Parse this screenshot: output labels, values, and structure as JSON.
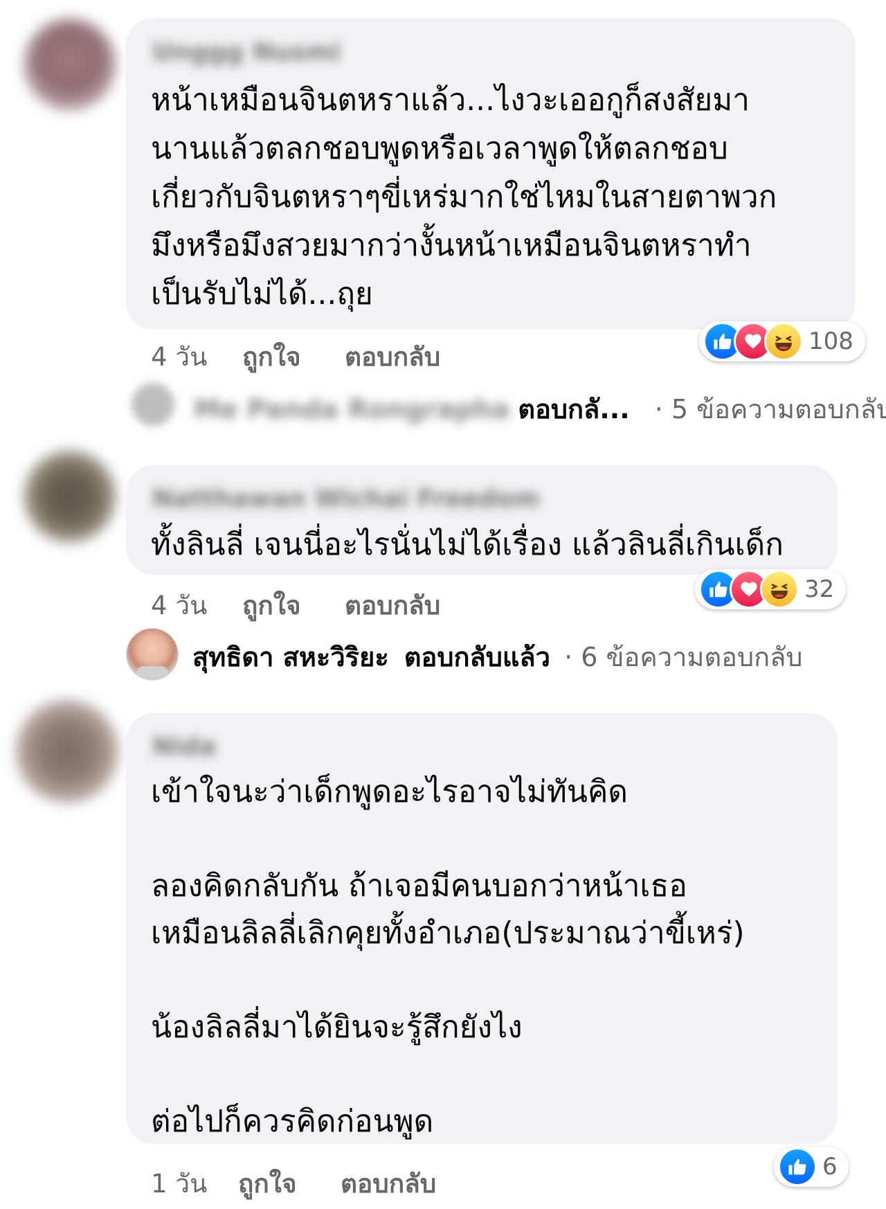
{
  "comments": [
    {
      "author": "Unggg Nusmi",
      "text": "หน้าเหมือนจินตหราแล้ว...ไงวะเออกูก็สงสัยมา\nนานแล้วตลกชอบพูดหรือเวลาพูดให้ตลกชอบ\nเกี่ยวกับจินตหราๆขี่เหร่มากใช่ไหมในสายตาพวก\nมึงหรือมึงสวยมากว่างั้นหน้าเหมือนจินตหราทำ\nเป็นรับไม่ได้...ถุย",
      "time": "4 วัน",
      "like_label": "ถูกใจ",
      "reply_label": "ตอบกลับ",
      "reaction_count": "108",
      "reactions": [
        "like-icon",
        "love-icon",
        "haha-icon"
      ],
      "replies_summary": {
        "replier": "Me Panda Rongrapha",
        "action": "ตอบกลั...",
        "count_text": "· 5 ข้อความตอบกลับ"
      }
    },
    {
      "author": "Natthawan Wichai Freedom",
      "text": "ทั้งลินลี่ เจนนี่อะไรนั่นไม่ได้เรื่อง แล้วลินลี่เกินเด็ก",
      "time": "4 วัน",
      "like_label": "ถูกใจ",
      "reply_label": "ตอบกลับ",
      "reaction_count": "32",
      "reactions": [
        "like-icon",
        "love-icon",
        "haha-icon"
      ],
      "replies_summary": {
        "replier": "สุทธิดา สหะวิริยะ",
        "action": "ตอบกลับแล้ว",
        "count_text": "· 6 ข้อความตอบกลับ"
      }
    },
    {
      "author": "Nida",
      "text": "เข้าใจนะว่าเด็กพูดอะไรอาจไม่ทันคิด\n\nลองคิดกลับกัน ถ้าเจอมีคนบอกว่าหน้าเธอ\nเหมือนลิลลี่เลิกคุยทั้งอำเภอ(ประมาณว่าขี้เหร่)\n\nน้องลิลลี่มาได้ยินจะรู้สึกยังไง\n\nต่อไปก็ควรคิดก่อนพูด",
      "time": "1 วัน",
      "like_label": "ถูกใจ",
      "reply_label": "ตอบกลับ",
      "reaction_count": "6",
      "reactions": [
        "like-icon"
      ]
    }
  ],
  "colors": {
    "bubble": "#f0f2f5",
    "meta": "#65676b",
    "like": "#0866ff",
    "love": "#e61e4d",
    "haha": "#f8b72f"
  }
}
